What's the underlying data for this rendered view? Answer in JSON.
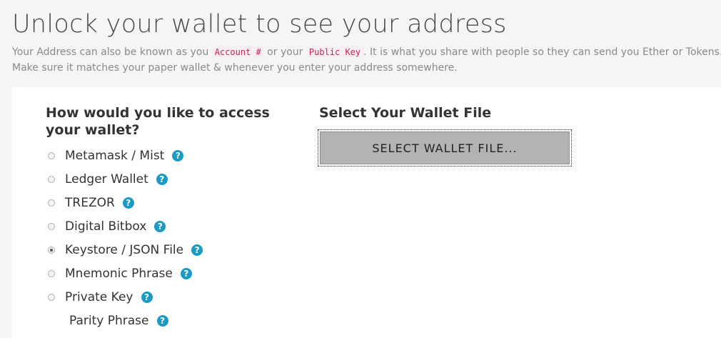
{
  "header": {
    "title": "Unlock your wallet to see your address",
    "intro": {
      "part1": "Your Address can also be known as you ",
      "code1": "Account #",
      "part2": " or your ",
      "code2": "Public Key",
      "part3": ". It is what you share with people so they can send you Ether or Tokens.",
      "line2": "Make sure it matches your paper wallet & whenever you enter your address somewhere."
    }
  },
  "access": {
    "heading": "How would you like to access your wallet?",
    "selected": "Keystore / JSON File",
    "options": [
      {
        "label": "Metamask / Mist",
        "help": "?"
      },
      {
        "label": "Ledger Wallet",
        "help": "?"
      },
      {
        "label": "TREZOR",
        "help": "?"
      },
      {
        "label": "Digital Bitbox",
        "help": "?"
      },
      {
        "label": "Keystore / JSON File",
        "help": "?"
      },
      {
        "label": "Mnemonic Phrase",
        "help": "?"
      },
      {
        "label": "Private Key",
        "help": "?"
      },
      {
        "label": "Parity Phrase",
        "help": "?"
      }
    ]
  },
  "wallet_file": {
    "heading": "Select Your Wallet File",
    "button_label": "SELECT WALLET FILE..."
  },
  "colors": {
    "help_icon": "#1a9bc5",
    "code_text": "#c7254e",
    "button_bg": "#b3b3b3"
  }
}
